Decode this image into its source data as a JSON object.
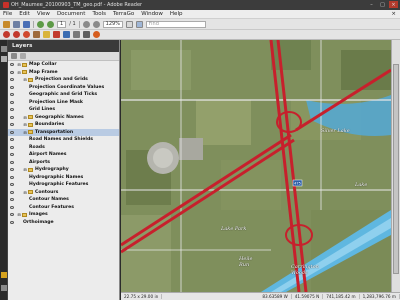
{
  "window": {
    "title": "OH_Maumee_20100903_TM_geo.pdf - Adobe Reader",
    "controls": [
      "–",
      "□",
      "×"
    ]
  },
  "menu": [
    "File",
    "Edit",
    "View",
    "Document",
    "Tools",
    "TerraGo",
    "Window",
    "Help"
  ],
  "toolbar": {
    "page_current": "1",
    "page_total": "/ 1",
    "zoom": "129%",
    "find_placeholder": "Find"
  },
  "layers_panel": {
    "title": "Layers",
    "items": [
      {
        "label": "Map Collar",
        "level": 0,
        "type": "folder"
      },
      {
        "label": "Map Frame",
        "level": 0,
        "type": "folder"
      },
      {
        "label": "Projection and Grids",
        "level": 1,
        "type": "folder"
      },
      {
        "label": "Projection Coordinate Values",
        "level": 2,
        "type": "leaf"
      },
      {
        "label": "Geographic and Grid Ticks",
        "level": 2,
        "type": "leaf"
      },
      {
        "label": "Projection Line Mask",
        "level": 2,
        "type": "leaf"
      },
      {
        "label": "Grid Lines",
        "level": 2,
        "type": "leaf"
      },
      {
        "label": "Geographic Names",
        "level": 1,
        "type": "folder"
      },
      {
        "label": "Boundaries",
        "level": 1,
        "type": "folder"
      },
      {
        "label": "Transportation",
        "level": 1,
        "type": "folder",
        "selected": true
      },
      {
        "label": "Road Names and Shields",
        "level": 2,
        "type": "leaf"
      },
      {
        "label": "Roads",
        "level": 2,
        "type": "leaf"
      },
      {
        "label": "Airport Names",
        "level": 2,
        "type": "leaf"
      },
      {
        "label": "Airports",
        "level": 2,
        "type": "leaf"
      },
      {
        "label": "Hydrography",
        "level": 1,
        "type": "folder"
      },
      {
        "label": "Hydrographic Names",
        "level": 2,
        "type": "leaf"
      },
      {
        "label": "Hydrographic Features",
        "level": 2,
        "type": "leaf"
      },
      {
        "label": "Contours",
        "level": 1,
        "type": "folder"
      },
      {
        "label": "Contour Names",
        "level": 2,
        "type": "leaf"
      },
      {
        "label": "Contour Features",
        "level": 2,
        "type": "leaf"
      },
      {
        "label": "Images",
        "level": 0,
        "type": "folder"
      },
      {
        "label": "Orthoimage",
        "level": 1,
        "type": "leaf"
      }
    ]
  },
  "map_labels": {
    "silver_lake": "Silver Lake",
    "lake": "Lake",
    "lake_park": "Lake Park",
    "heile_run": "Heile\nRun",
    "carrington_woods": "Carrington\nWoods",
    "shield": "475"
  },
  "status": {
    "page_size": "22.75 x 29.00 in",
    "coord1": "83.63589 W",
    "coord2": "41.59075 N",
    "coord3": "741,185.42 m",
    "coord4": "1,283,796.76 m"
  },
  "colors": {
    "road_red": "#c7202c",
    "water": "#5fb7e0",
    "titlebar": "#3c3c3c"
  }
}
